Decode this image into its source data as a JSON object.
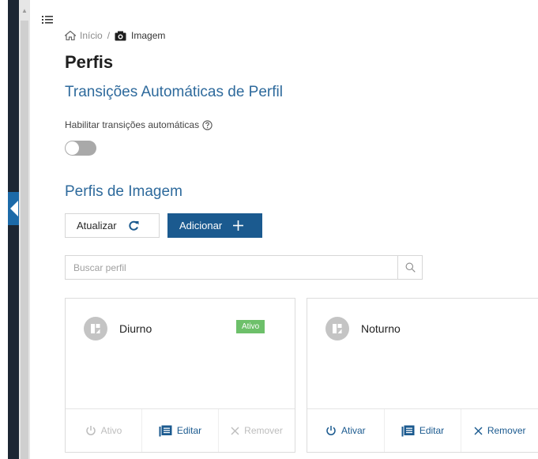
{
  "breadcrumb": {
    "home_icon": "home-icon",
    "home_label": "Início",
    "separator": "/",
    "current_icon": "camera-icon",
    "current_label": "Imagem"
  },
  "page_title": "Perfis",
  "auto_transitions": {
    "section_title": "Transições Automáticas de Perfil",
    "enable_label": "Habilitar transições automáticas",
    "help_icon": "help-icon",
    "toggle_enabled": false
  },
  "image_profiles": {
    "section_title": "Perfis de Imagem",
    "refresh_label": "Atualizar",
    "refresh_icon": "refresh-icon",
    "add_label": "Adicionar",
    "add_icon": "plus-icon",
    "search_placeholder": "Buscar perfil",
    "search_value": "",
    "search_icon": "search-icon",
    "cards": [
      {
        "name": "Diurno",
        "badge": "Ativo",
        "activate_label": "Ativo",
        "activate_enabled": false,
        "edit_label": "Editar",
        "remove_label": "Remover",
        "remove_enabled": false
      },
      {
        "name": "Noturno",
        "badge": "",
        "activate_label": "Ativar",
        "activate_enabled": true,
        "edit_label": "Editar",
        "remove_label": "Remover",
        "remove_enabled": true
      }
    ]
  },
  "colors": {
    "primary": "#1b5a8f",
    "section_title": "#2e6a9c",
    "badge_active": "#6dc06a",
    "sidebar_dark": "#1c2633",
    "sidebar_toggle": "#1c6aa8"
  }
}
